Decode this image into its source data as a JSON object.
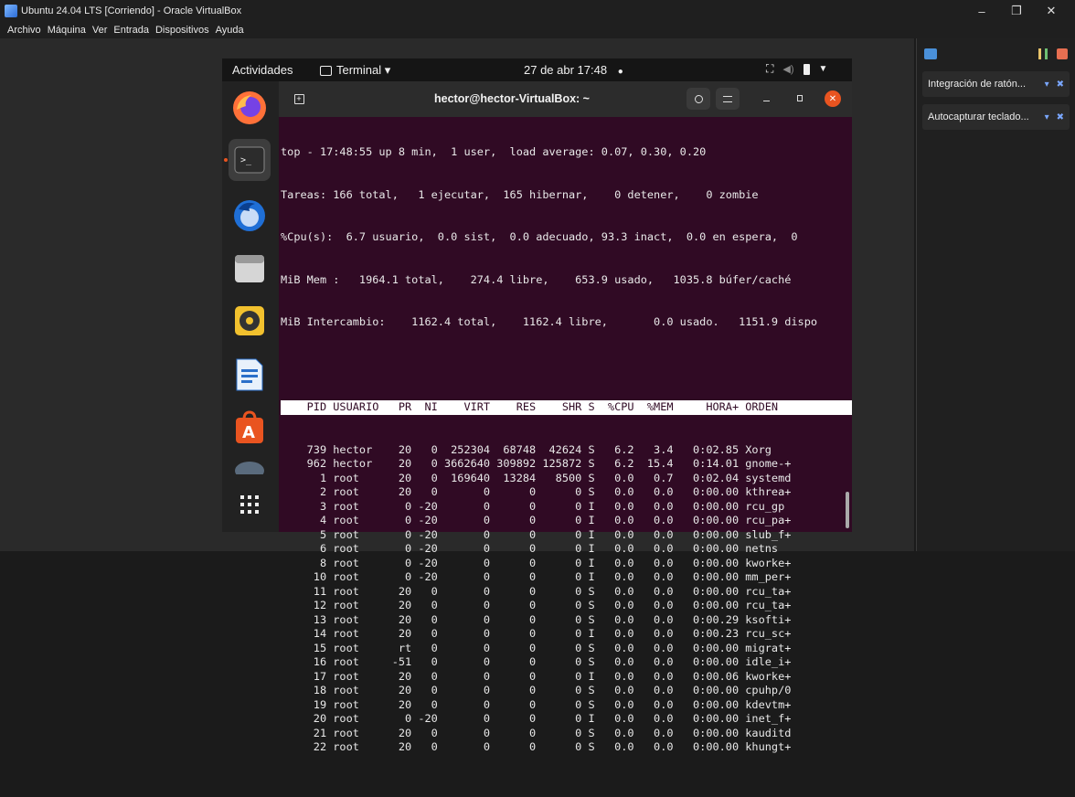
{
  "window": {
    "title": "Ubuntu 24.04 LTS [Corriendo] - Oracle VirtualBox",
    "controls": [
      "–",
      "❐",
      "✕"
    ]
  },
  "menubar": [
    "Archivo",
    "Máquina",
    "Ver",
    "Entrada",
    "Dispositivos",
    "Ayuda"
  ],
  "side_panel": {
    "items": [
      {
        "label": "Integración de ratón..."
      },
      {
        "label": "Autocapturar teclado..."
      }
    ]
  },
  "gnome_topbar": {
    "activities": "Actividades",
    "app": "Terminal ▾",
    "clock": "27 de abr  17:48",
    "dot": "●"
  },
  "dock": {
    "apps": [
      "firefox-icon",
      "terminal-icon",
      "thunderbird-icon",
      "files-icon",
      "rhythmbox-icon",
      "writer-icon",
      "app-center-icon",
      "disc-icon",
      "app-grid-icon"
    ]
  },
  "terminal": {
    "title": "hector@hector-VirtualBox: ~",
    "summary": [
      "top - 17:48:55 up 8 min,  1 user,  load average: 0.07, 0.30, 0.20",
      "Tareas: 166 total,   1 ejecutar,  165 hibernar,    0 detener,    0 zombie",
      "%Cpu(s):  6.7 usuario,  0.0 sist,  0.0 adecuado, 93.3 inact,  0.0 en espera,  0",
      "MiB Mem :   1964.1 total,    274.4 libre,    653.9 usado,   1035.8 búfer/caché",
      "MiB Intercambio:    1162.4 total,    1162.4 libre,       0.0 usado.   1151.9 dispo"
    ],
    "header": "    PID USUARIO   PR  NI    VIRT    RES    SHR S  %CPU  %MEM     HORA+ ORDEN",
    "rows": [
      "    739 hector    20   0  252304  68748  42624 S   6.2   3.4   0:02.85 Xorg",
      "    962 hector    20   0 3662640 309892 125872 S   6.2  15.4   0:14.01 gnome-+",
      "      1 root      20   0  169640  13284   8500 S   0.0   0.7   0:02.04 systemd",
      "      2 root      20   0       0      0      0 S   0.0   0.0   0:00.00 kthrea+",
      "      3 root       0 -20       0      0      0 I   0.0   0.0   0:00.00 rcu_gp",
      "      4 root       0 -20       0      0      0 I   0.0   0.0   0:00.00 rcu_pa+",
      "      5 root       0 -20       0      0      0 I   0.0   0.0   0:00.00 slub_f+",
      "      6 root       0 -20       0      0      0 I   0.0   0.0   0:00.00 netns",
      "      8 root       0 -20       0      0      0 I   0.0   0.0   0:00.00 kworke+",
      "     10 root       0 -20       0      0      0 I   0.0   0.0   0:00.00 mm_per+",
      "     11 root      20   0       0      0      0 S   0.0   0.0   0:00.00 rcu_ta+",
      "     12 root      20   0       0      0      0 S   0.0   0.0   0:00.00 rcu_ta+",
      "     13 root      20   0       0      0      0 S   0.0   0.0   0:00.29 ksofti+",
      "     14 root      20   0       0      0      0 I   0.0   0.0   0:00.23 rcu_sc+",
      "     15 root      rt   0       0      0      0 S   0.0   0.0   0:00.00 migrat+",
      "     16 root     -51   0       0      0      0 S   0.0   0.0   0:00.00 idle_i+",
      "     17 root      20   0       0      0      0 I   0.0   0.0   0:00.06 kworke+",
      "     18 root      20   0       0      0      0 S   0.0   0.0   0:00.00 cpuhp/0",
      "     19 root      20   0       0      0      0 S   0.0   0.0   0:00.00 kdevtm+",
      "     20 root       0 -20       0      0      0 I   0.0   0.0   0:00.00 inet_f+",
      "     21 root      20   0       0      0      0 S   0.0   0.0   0:00.00 kauditd",
      "     22 root      20   0       0      0      0 S   0.0   0.0   0:00.00 khungt+"
    ]
  }
}
